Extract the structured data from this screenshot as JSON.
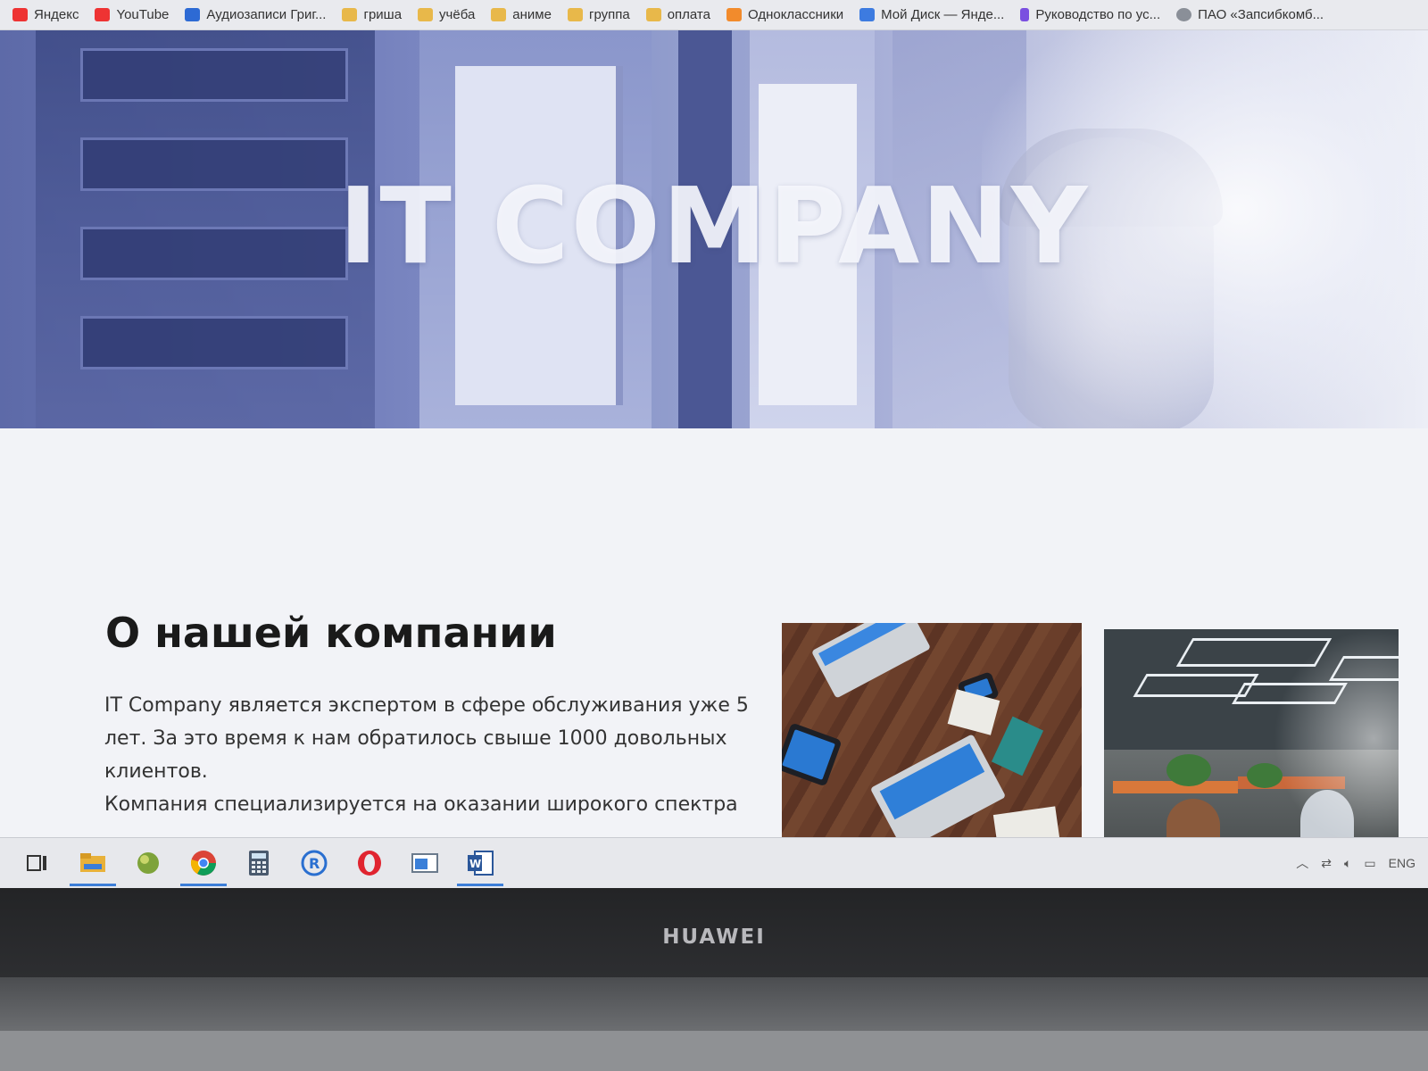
{
  "bookmarks": [
    {
      "label": "Яндекс",
      "icon": "yandex-icon"
    },
    {
      "label": "YouTube",
      "icon": "youtube-icon"
    },
    {
      "label": "Аудиозаписи Григ...",
      "icon": "vk-icon"
    },
    {
      "label": "гриша",
      "icon": "folder-icon"
    },
    {
      "label": "учёба",
      "icon": "folder-icon"
    },
    {
      "label": "аниме",
      "icon": "folder-icon"
    },
    {
      "label": "группа",
      "icon": "folder-icon"
    },
    {
      "label": "оплата",
      "icon": "folder-icon"
    },
    {
      "label": "Одноклассники",
      "icon": "odnoklassniki-icon"
    },
    {
      "label": "Мой Диск — Янде...",
      "icon": "yandex-disk-icon"
    },
    {
      "label": "Руководство по ус...",
      "icon": "guide-icon"
    },
    {
      "label": "ПАО «Запсибкомб...",
      "icon": "bank-icon"
    }
  ],
  "hero": {
    "title": "IT COMPANY"
  },
  "about": {
    "title": "О нашей компании",
    "paragraph1": "IT Company является экспертом в сфере обслуживания уже 5 лет. За это время к нам обратилось свыше 1000 довольных клиентов.",
    "paragraph2": "Компания специализируется на оказании широкого спектра"
  },
  "taskbar": {
    "apps": [
      "task-view-icon",
      "file-explorer-icon",
      "app-green-icon",
      "chrome-icon",
      "calculator-icon",
      "app-blue-circle-icon",
      "opera-icon",
      "app-window-icon",
      "word-icon"
    ],
    "tray_language": "ENG"
  },
  "laptop": {
    "brand": "HUAWEI"
  }
}
